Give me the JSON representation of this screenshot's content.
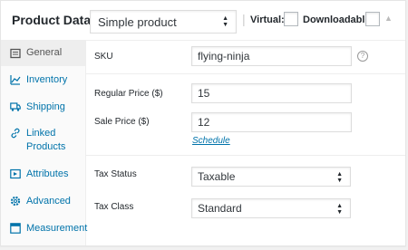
{
  "header": {
    "title": "Product Data —",
    "product_type": "Simple product",
    "virtual_label": "Virtual:",
    "downloadable_label": "Downloadable:",
    "virtual_checked": false,
    "downloadable_checked": false
  },
  "tabs": [
    {
      "label": "General",
      "icon": "general-icon",
      "active": true
    },
    {
      "label": "Inventory",
      "icon": "inventory-icon",
      "active": false
    },
    {
      "label": "Shipping",
      "icon": "shipping-icon",
      "active": false
    },
    {
      "label": "Linked Products",
      "icon": "link-icon",
      "active": false
    },
    {
      "label": "Attributes",
      "icon": "attributes-icon",
      "active": false
    },
    {
      "label": "Advanced",
      "icon": "gear-icon",
      "active": false
    },
    {
      "label": "Measurement",
      "icon": "measurement-icon",
      "active": false
    }
  ],
  "general": {
    "sku_label": "SKU",
    "sku_value": "flying-ninja",
    "regular_price_label": "Regular Price ($)",
    "regular_price_value": "15",
    "sale_price_label": "Sale Price ($)",
    "sale_price_value": "12",
    "schedule_link": "Schedule",
    "tax_status_label": "Tax Status",
    "tax_status_value": "Taxable",
    "tax_class_label": "Tax Class",
    "tax_class_value": "Standard"
  },
  "colors": {
    "link": "#0073aa",
    "text": "#23282d",
    "tab_active_bg": "#eeeeee"
  }
}
